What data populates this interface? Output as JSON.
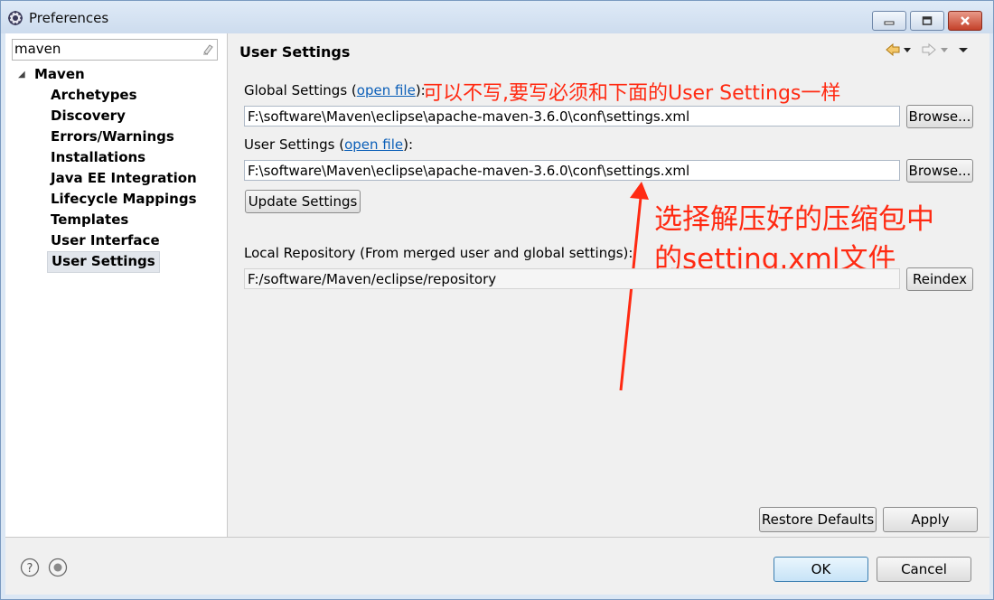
{
  "window": {
    "title": "Preferences"
  },
  "filter": {
    "value": "maven"
  },
  "tree": {
    "root": "Maven",
    "items": [
      {
        "label": "Archetypes"
      },
      {
        "label": "Discovery"
      },
      {
        "label": "Errors/Warnings"
      },
      {
        "label": "Installations"
      },
      {
        "label": "Java EE Integration"
      },
      {
        "label": "Lifecycle Mappings"
      },
      {
        "label": "Templates"
      },
      {
        "label": "User Interface"
      },
      {
        "label": "User Settings",
        "selected": true
      }
    ]
  },
  "page": {
    "title": "User Settings",
    "global": {
      "label_prefix": "Global Settings (",
      "link": "open file",
      "label_suffix": "):",
      "annotation": "可以不写,要写必须和下面的User Settings一样",
      "value": "F:\\software\\Maven\\eclipse\\apache-maven-3.6.0\\conf\\settings.xml",
      "browse": "Browse..."
    },
    "user": {
      "label_prefix": "User Settings (",
      "link": "open file",
      "label_suffix": "):",
      "value": "F:\\software\\Maven\\eclipse\\apache-maven-3.6.0\\conf\\settings.xml",
      "browse": "Browse..."
    },
    "update_button": "Update Settings",
    "annotation_line1": "选择解压好的压缩包中",
    "annotation_line2": "的setting.xml文件",
    "local_repo": {
      "label": "Local Repository (From merged user and global settings):",
      "value": "F:/software/Maven/eclipse/repository",
      "reindex": "Reindex"
    },
    "restore_defaults": "Restore Defaults",
    "apply": "Apply"
  },
  "footer": {
    "ok": "OK",
    "cancel": "Cancel"
  },
  "colors": {
    "annotation": "#ff2a12",
    "link": "#0b5fb8",
    "selection": "#e2e6ec"
  }
}
